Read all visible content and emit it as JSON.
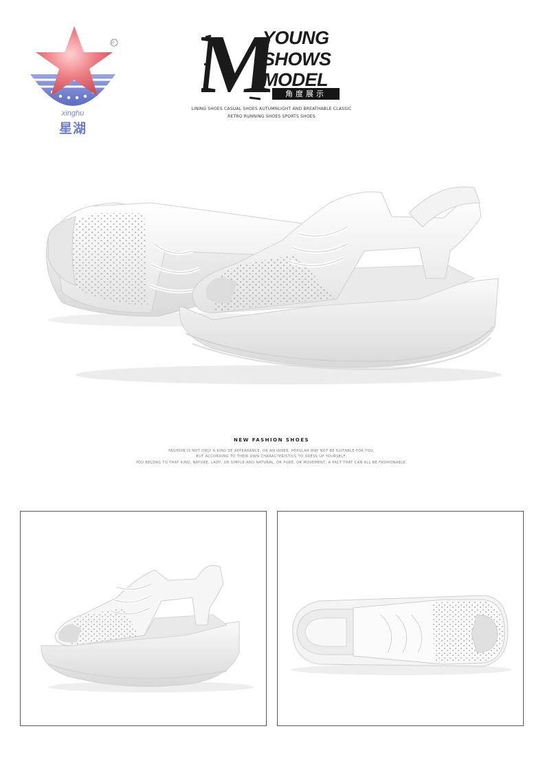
{
  "brand": {
    "registered_mark": "®",
    "name_latin": "xinghu",
    "name_cn": "星湖"
  },
  "header": {
    "m_letter": "M",
    "words": [
      "YOUNG",
      "SHOWS",
      "MODEL"
    ],
    "tag_cn": "角度展示",
    "subtitle_line1": "LINING SHOES CASUAL SHOES AUTUMNLIGHT AND BREATHABLE CLASSIC",
    "subtitle_line2": "RETRO RUNNING SHOES SPORTS SHOES"
  },
  "fashion": {
    "heading": "NEW FASHION SHOES",
    "lines": [
      "FASHION IS NOT ONLY A KIND OF APPEARANCE, OR AN INNER, POPULAR MAY NOT BE SUITABLE FOR YOU,",
      "BUT ACCORDING TO THEIR OWN CHARACTERISTICS TO DRESS UP YOURSELF,",
      "YOU BELONG TO THAT KIND, NATURE, LADY, OR SIMPLE AND NATURAL, OR PURE, OR MOVEMENT, A FACT THAT CAN ALL BE FASHIONABLE."
    ]
  },
  "colors": {
    "background": "#ffffff",
    "shoe_white": "#f2f2f2",
    "shoe_shadow": "#c9c9c9",
    "logo_star": "#e8737a",
    "logo_blue": "#6e7ccc",
    "text_dark": "#1c1c1c"
  },
  "images": {
    "hero": "white-perforated-platform-sandals-pair",
    "detail_left": "sandal-side-view",
    "detail_right": "sandal-top-view"
  }
}
